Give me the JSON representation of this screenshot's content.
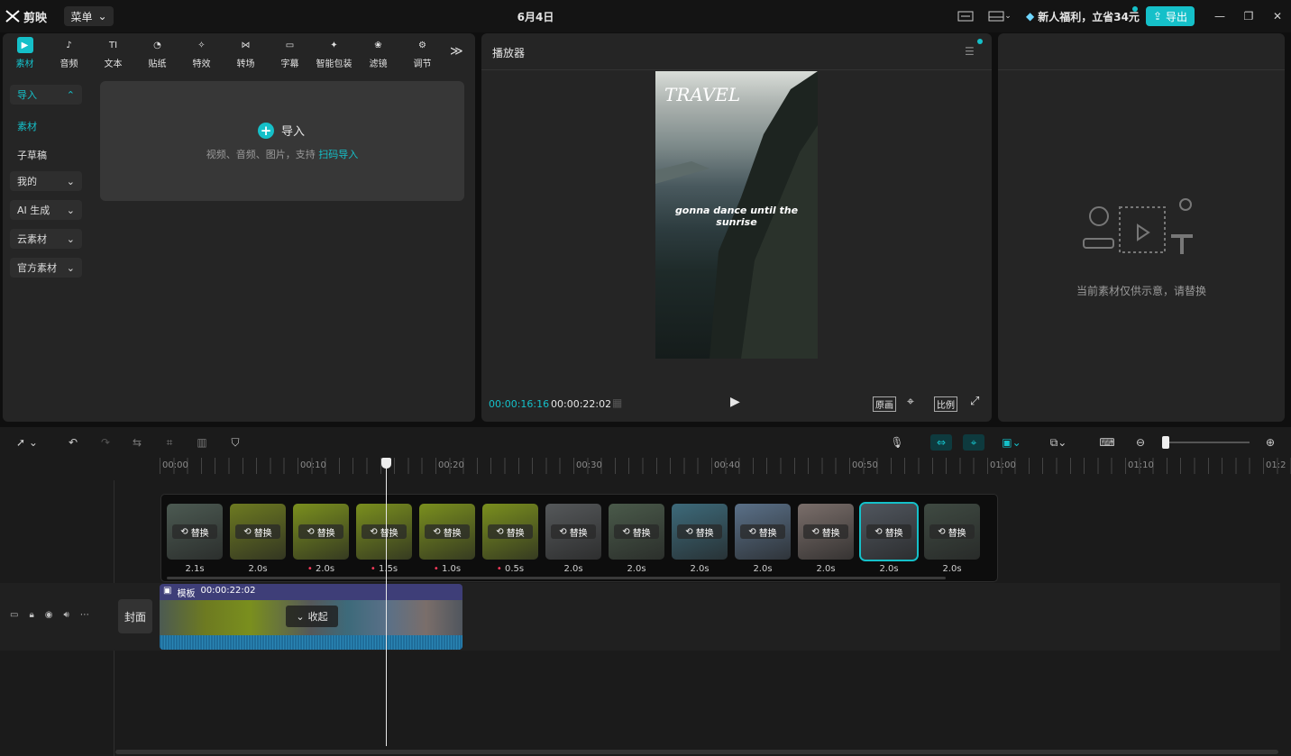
{
  "app": {
    "name": "剪映",
    "menu_label": "菜单",
    "title": "6月4日",
    "promo": "新人福利，立省34元",
    "export_label": "导出"
  },
  "media_tabs": [
    {
      "label": "素材",
      "icon": "media-icon",
      "active": true
    },
    {
      "label": "音频",
      "icon": "audio-icon"
    },
    {
      "label": "文本",
      "icon": "text-icon"
    },
    {
      "label": "贴纸",
      "icon": "sticker-icon"
    },
    {
      "label": "特效",
      "icon": "effects-icon"
    },
    {
      "label": "转场",
      "icon": "transition-icon"
    },
    {
      "label": "字幕",
      "icon": "subtitle-icon"
    },
    {
      "label": "智能包装",
      "icon": "smart-pack-icon"
    },
    {
      "label": "滤镜",
      "icon": "filter-icon"
    },
    {
      "label": "调节",
      "icon": "adjust-icon"
    }
  ],
  "sidebar": {
    "import": "导入",
    "material": "素材",
    "subdraft": "子草稿",
    "mine": "我的",
    "ai": "AI 生成",
    "cloud": "云素材",
    "official": "官方素材"
  },
  "import_card": {
    "title": "导入",
    "hint": "视频、音频、图片，支持",
    "link": "扫码导入"
  },
  "player": {
    "title": "播放器",
    "current_time": "00:00:16:16",
    "total_time": "00:00:22:02",
    "btn_original": "原画",
    "btn_ratio": "比例",
    "overlay_title": "TRAVEL",
    "overlay_caption": "gonna dance until the sunrise"
  },
  "right_panel": {
    "hint": "当前素材仅供示意，请替换"
  },
  "ruler": [
    "00:00",
    "00:10",
    "00:20",
    "00:30",
    "00:40",
    "00:50",
    "01:00",
    "01:10",
    "01:2"
  ],
  "clips": [
    {
      "dur": "2.1s",
      "mark": false,
      "color": "#4c5a52"
    },
    {
      "dur": "2.0s",
      "mark": false,
      "color": "#6d7a21"
    },
    {
      "dur": "2.0s",
      "mark": true,
      "color": "#7a8f1e"
    },
    {
      "dur": "1.5s",
      "mark": true,
      "color": "#7a8f1e"
    },
    {
      "dur": "1.0s",
      "mark": true,
      "color": "#7a8f1e"
    },
    {
      "dur": "0.5s",
      "mark": true,
      "color": "#7a8f1e"
    },
    {
      "dur": "2.0s",
      "mark": false,
      "color": "#55585a"
    },
    {
      "dur": "2.0s",
      "mark": false,
      "color": "#4a5a4a"
    },
    {
      "dur": "2.0s",
      "mark": false,
      "color": "#3d6a7a"
    },
    {
      "dur": "2.0s",
      "mark": false,
      "color": "#5a7088"
    },
    {
      "dur": "2.0s",
      "mark": false,
      "color": "#7a6e6a"
    },
    {
      "dur": "2.0s",
      "mark": false,
      "color": "#50565e",
      "selected": true
    },
    {
      "dur": "2.0s",
      "mark": false,
      "color": "#3f4a42"
    }
  ],
  "replace_label": "替换",
  "track": {
    "cover_label": "封面",
    "template_label": "模板",
    "template_time": "00:00:22:02",
    "collapse_label": "收起"
  }
}
